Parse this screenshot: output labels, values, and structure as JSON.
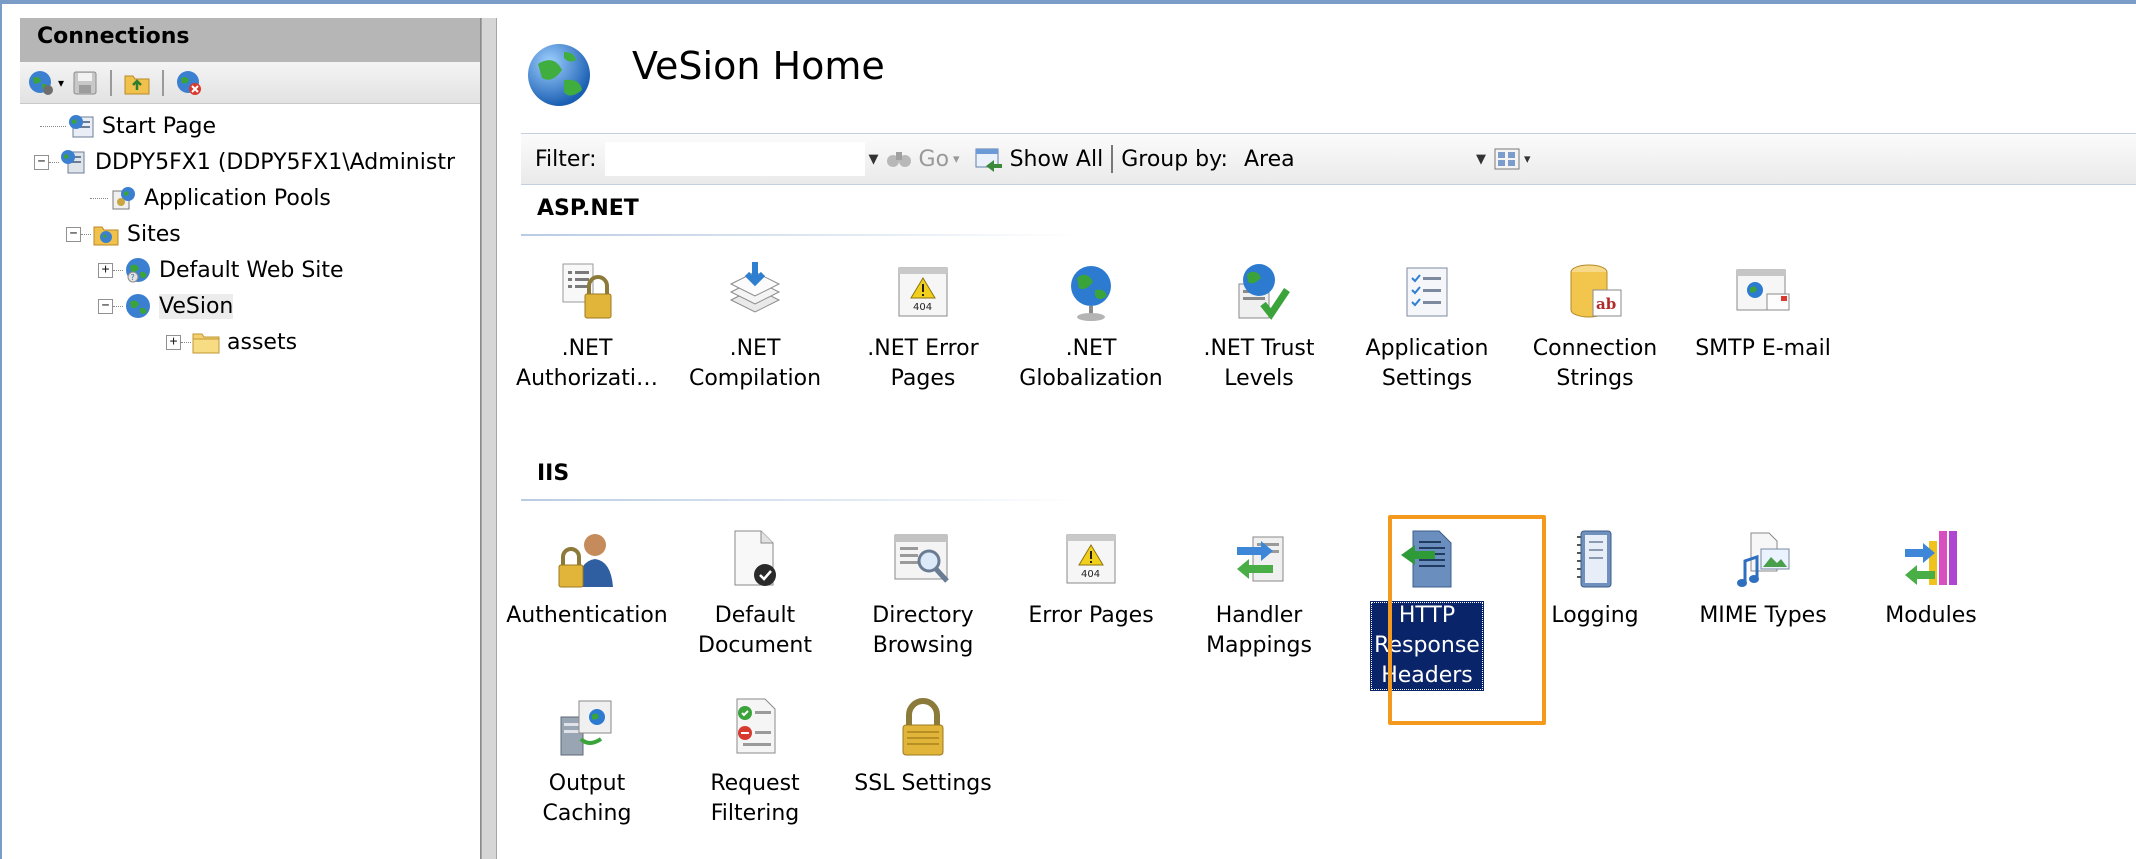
{
  "connections": {
    "title": "Connections",
    "tree": [
      {
        "label": "Start Page",
        "icon": "start-page-icon"
      },
      {
        "label": "DDPY5FX1 (DDPY5FX1\\Administr",
        "icon": "server-icon",
        "expander": "−"
      },
      {
        "label": "Application Pools",
        "icon": "app-pools-icon"
      },
      {
        "label": "Sites",
        "icon": "sites-folder-icon",
        "expander": "−"
      },
      {
        "label": "Default Web Site",
        "icon": "website-globe-icon",
        "expander": "+"
      },
      {
        "label": "VeSion",
        "icon": "website-globe-icon",
        "expander": "−"
      },
      {
        "label": "assets",
        "icon": "folder-icon",
        "expander": "+"
      }
    ]
  },
  "home": {
    "title": "VeSion Home"
  },
  "filter": {
    "label": "Filter:",
    "go_label": "Go",
    "show_all_label": "Show All",
    "group_by_label": "Group by:",
    "group_by_value": "Area"
  },
  "sections": [
    {
      "name": "ASP.NET",
      "features": [
        {
          "label": ".NET\nAuthorizati…",
          "icon": "dotnet-authorization-icon"
        },
        {
          "label": ".NET\nCompilation",
          "icon": "dotnet-compilation-icon"
        },
        {
          "label": ".NET Error\nPages",
          "icon": "dotnet-error-pages-icon"
        },
        {
          "label": ".NET\nGlobalization",
          "icon": "dotnet-globalization-icon"
        },
        {
          "label": ".NET Trust\nLevels",
          "icon": "dotnet-trust-levels-icon"
        },
        {
          "label": "Application\nSettings",
          "icon": "application-settings-icon"
        },
        {
          "label": "Connection\nStrings",
          "icon": "connection-strings-icon"
        },
        {
          "label": "SMTP E-mail",
          "icon": "smtp-email-icon"
        }
      ]
    },
    {
      "name": "IIS",
      "features": [
        {
          "label": "Authentication",
          "icon": "authentication-icon"
        },
        {
          "label": "Default\nDocument",
          "icon": "default-document-icon"
        },
        {
          "label": "Directory\nBrowsing",
          "icon": "directory-browsing-icon"
        },
        {
          "label": "Error Pages",
          "icon": "error-pages-icon"
        },
        {
          "label": "Handler\nMappings",
          "icon": "handler-mappings-icon"
        },
        {
          "label": "HTTP\nResponse\nHeaders",
          "icon": "http-response-headers-icon",
          "selected": true
        },
        {
          "label": "Logging",
          "icon": "logging-icon"
        },
        {
          "label": "MIME Types",
          "icon": "mime-types-icon"
        },
        {
          "label": "Modules",
          "icon": "modules-icon"
        },
        {
          "label": "Output\nCaching",
          "icon": "output-caching-icon"
        },
        {
          "label": "Request\nFiltering",
          "icon": "request-filtering-icon"
        },
        {
          "label": "SSL Settings",
          "icon": "ssl-settings-icon"
        }
      ]
    }
  ],
  "colors": {
    "selection_bg": "#0a246a",
    "highlight_border": "#f39a1e",
    "frame_border": "#7b9cc6"
  }
}
